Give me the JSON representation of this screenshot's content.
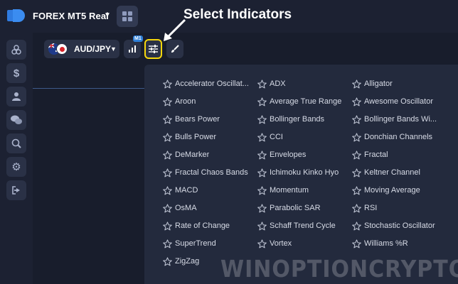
{
  "header": {
    "account_name": "FOREX MT5 Real",
    "annotation": "Select Indicators"
  },
  "toolbar": {
    "pair": "AUD/JPY",
    "timeframe_badge": "M1"
  },
  "sidebar": {
    "icons": [
      "balance-icon",
      "dollar-icon",
      "user-icon",
      "chat-icon",
      "search-chart-icon",
      "gear-icon",
      "logout-icon"
    ]
  },
  "indicators": {
    "columns": [
      [
        "Accelerator Oscillat...",
        "Aroon",
        "Bears Power",
        "Bulls Power",
        "DeMarker",
        "Fractal Chaos Bands",
        "MACD",
        "OsMA",
        "Rate of Change",
        "SuperTrend",
        "ZigZag"
      ],
      [
        "ADX",
        "Average True Range",
        "Bollinger Bands",
        "CCI",
        "Envelopes",
        "Ichimoku Kinko Hyo",
        "Momentum",
        "Parabolic SAR",
        "Schaff Trend Cycle",
        "Vortex"
      ],
      [
        "Alligator",
        "Awesome Oscillator",
        "Bollinger Bands Wi...",
        "Donchian Channels",
        "Fractal",
        "Keltner Channel",
        "Moving Average",
        "RSI",
        "Stochastic Oscillator",
        "Williams %R"
      ]
    ]
  },
  "watermark": "WINOPTIONCRYPTO.COM",
  "colors": {
    "highlight": "#f6d70c",
    "badge": "#2e7fd8",
    "brand": "#2f7be0"
  }
}
